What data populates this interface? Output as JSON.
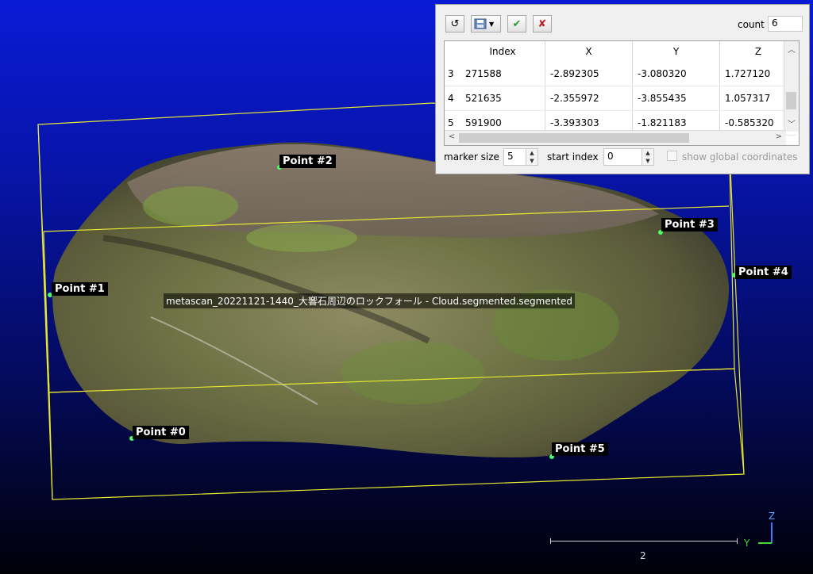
{
  "scene": {
    "cloud_label": "metascan_20221121-1440_大響石周辺のロックフォール - Cloud.segmented.segmented",
    "points": [
      {
        "label": "Point #0"
      },
      {
        "label": "Point #1"
      },
      {
        "label": "Point #2"
      },
      {
        "label": "Point #3"
      },
      {
        "label": "Point #4"
      },
      {
        "label": "Point #5"
      }
    ],
    "scale_value": "2",
    "axes": {
      "z": "Z",
      "y": "Y"
    },
    "colors": {
      "bbox": "#ffff33",
      "marker": "#44ff66"
    }
  },
  "panel": {
    "count_label": "count",
    "count_value": "6",
    "table": {
      "headers": [
        "Index",
        "X",
        "Y",
        "Z"
      ],
      "rows": [
        {
          "row": "3",
          "index": "271588",
          "x": "-2.892305",
          "y": "-3.080320",
          "z": "1.727120"
        },
        {
          "row": "4",
          "index": "521635",
          "x": "-2.355972",
          "y": "-3.855435",
          "z": "1.057317"
        },
        {
          "row": "5",
          "index": "591900",
          "x": "-3.393303",
          "y": "-1.821183",
          "z": "-0.585320"
        }
      ]
    },
    "marker_size_label": "marker size",
    "marker_size_value": "5",
    "start_index_label": "start index",
    "start_index_value": "0",
    "global_coords_label": "show global coordinates"
  }
}
